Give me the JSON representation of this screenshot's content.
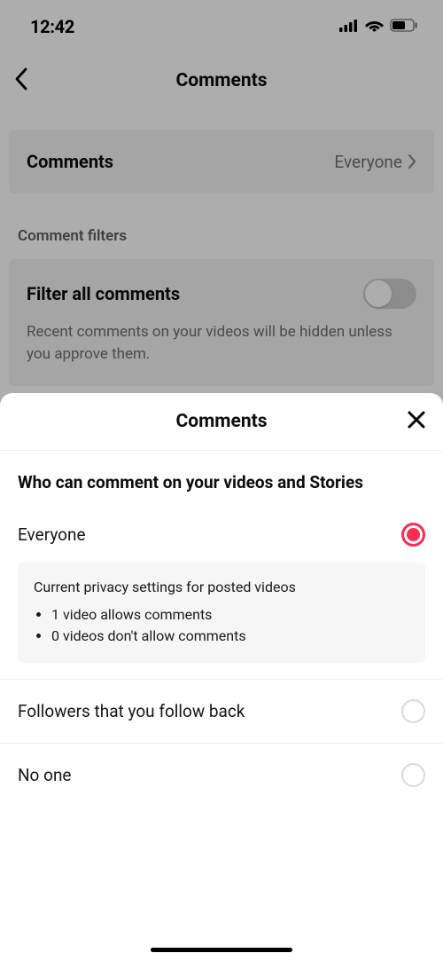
{
  "status": {
    "time": "12:42"
  },
  "nav": {
    "title": "Comments"
  },
  "comments_setting": {
    "label": "Comments",
    "value": "Everyone"
  },
  "section_header": "Comment filters",
  "filter": {
    "title": "Filter all comments",
    "desc": "Recent comments on your videos will be hidden unless you approve them.",
    "enabled": false
  },
  "sheet": {
    "title": "Comments",
    "question": "Who can comment on your videos and Stories",
    "options": [
      {
        "label": "Everyone",
        "selected": true
      },
      {
        "label": "Followers that you follow back",
        "selected": false
      },
      {
        "label": "No one",
        "selected": false
      }
    ],
    "info": {
      "title": "Current privacy settings for posted videos",
      "lines": [
        "1 video allows comments",
        "0 videos don't allow comments"
      ]
    }
  }
}
